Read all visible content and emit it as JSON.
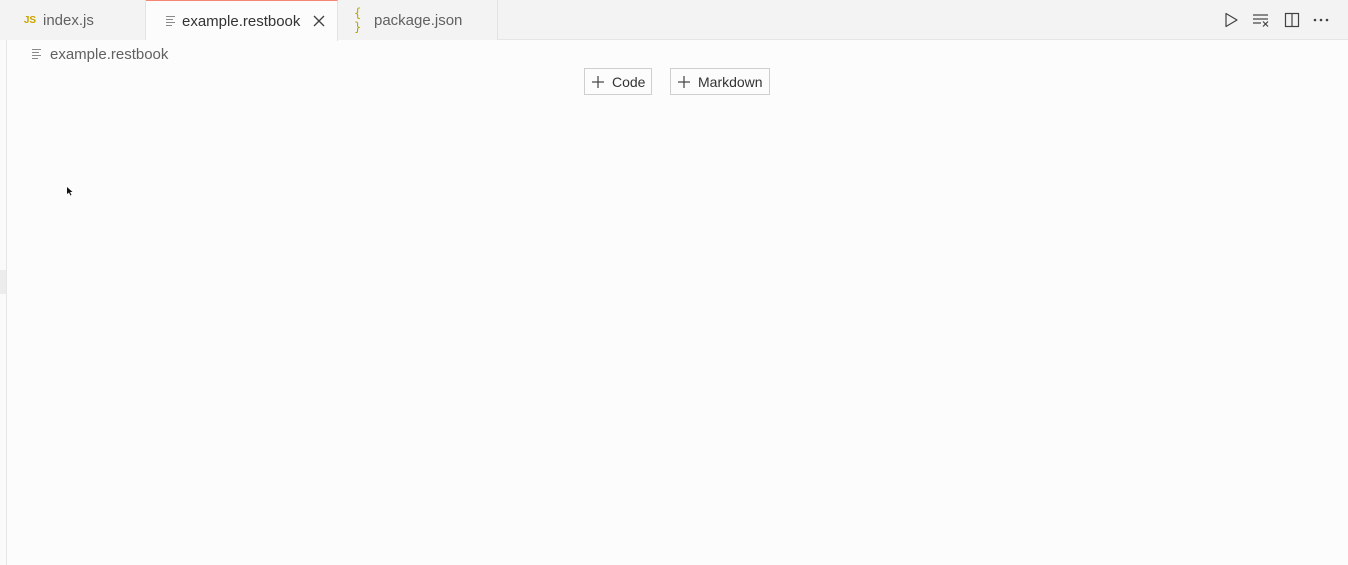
{
  "tabs": [
    {
      "label": "index.js",
      "icon": "js-file-icon",
      "icon_text": "JS"
    },
    {
      "label": "example.restbook",
      "icon": "notebook-file-icon",
      "active": true
    },
    {
      "label": "package.json",
      "icon": "json-file-icon",
      "icon_text": "{ }"
    }
  ],
  "toolbar": {
    "run_all": "run-all-icon",
    "clear_outputs": "clear-all-outputs-icon",
    "split_editor": "split-editor-icon",
    "more": "more-actions-icon"
  },
  "breadcrumb": {
    "label": "example.restbook"
  },
  "notebook": {
    "add_code_label": "Code",
    "add_markdown_label": "Markdown"
  },
  "colors": {
    "active_tab_border": "#f48771",
    "background": "#fcfcfd",
    "tabbar": "#f3f3f3"
  }
}
